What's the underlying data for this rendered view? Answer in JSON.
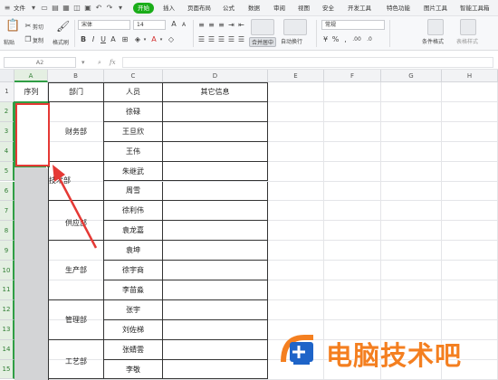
{
  "menubar": {
    "file_label": "文件",
    "tabs": [
      "开始",
      "插入",
      "页面布局",
      "公式",
      "数据",
      "审阅",
      "视图",
      "安全",
      "开发工具",
      "特色功能",
      "图片工具",
      "智能工具箱"
    ],
    "active_tab": "开始"
  },
  "ribbon": {
    "cut_label": "剪切",
    "copy_label": "复制",
    "paste_label": "粘贴",
    "format_painter_label": "格式刷",
    "font_name": "宋体",
    "font_size": "14",
    "merge_center_label": "合并居中",
    "wrap_text_label": "自动换行",
    "number_format": "常规",
    "conditional_format_label": "条件格式",
    "table_style_label": "表格样式"
  },
  "formula_bar": {
    "cell_ref": "A2",
    "fx_label": "fx",
    "content": ""
  },
  "grid": {
    "columns": [
      "A",
      "B",
      "C",
      "D",
      "E",
      "F",
      "G",
      "H"
    ],
    "rows": [
      "1",
      "2",
      "3",
      "4",
      "5",
      "6",
      "7",
      "8",
      "9",
      "10",
      "11",
      "12",
      "13",
      "14",
      "15"
    ],
    "headers": {
      "seq": "序列",
      "dept": "部门",
      "person": "人员",
      "other": "其它信息"
    },
    "departments": [
      "财务部",
      "技术部",
      "供应部",
      "生产部",
      "管理部",
      "工艺部"
    ],
    "people": [
      "徐碌",
      "王旦欣",
      "王伟",
      "朱继武",
      "周雪",
      "徐利伟",
      "袁龙嘉",
      "袁坤",
      "徐宇商",
      "李苗淼",
      "张宇",
      "刘佐梯",
      "张蜻雲",
      "李敬"
    ]
  },
  "watermark": {
    "text": "电脑技术吧"
  },
  "colors": {
    "accent_green": "#1aad19",
    "selection_green": "#2f9e44",
    "annotation_red": "#e53935",
    "watermark_orange": "#f47f20",
    "watermark_blue": "#1e64c8"
  }
}
